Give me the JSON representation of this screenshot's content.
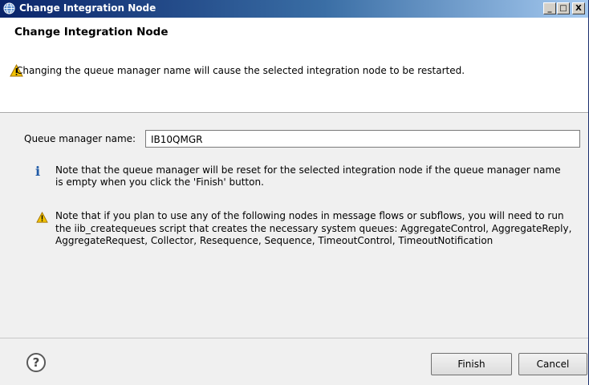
{
  "window": {
    "title": "Change Integration Node",
    "minimize_label": "_",
    "maximize_label": "□",
    "close_label": "X"
  },
  "header": {
    "title": "Change Integration Node",
    "message": "Changing the queue manager name will cause the selected integration node to be restarted."
  },
  "form": {
    "queue_manager_label": "Queue manager name:",
    "queue_manager_value": "IB10QMGR"
  },
  "notes": {
    "info": "Note that the queue manager will be reset for the selected integration node if the queue manager name is empty when you click the 'Finish' button.",
    "warning": "Note that if you plan to use any of the following nodes in message flows or subflows, you will need to run the iib_createqueues script that creates the necessary system queues: AggregateControl, AggregateReply, AggregateRequest, Collector, Resequence, Sequence, TimeoutControl, TimeoutNotification"
  },
  "footer": {
    "help_label": "?",
    "finish_label": "Finish",
    "cancel_label": "Cancel"
  },
  "colors": {
    "titlebar_start": "#0a246a",
    "titlebar_end": "#a6caf0",
    "warning": "#f2c200",
    "info": "#1f5aa6"
  }
}
